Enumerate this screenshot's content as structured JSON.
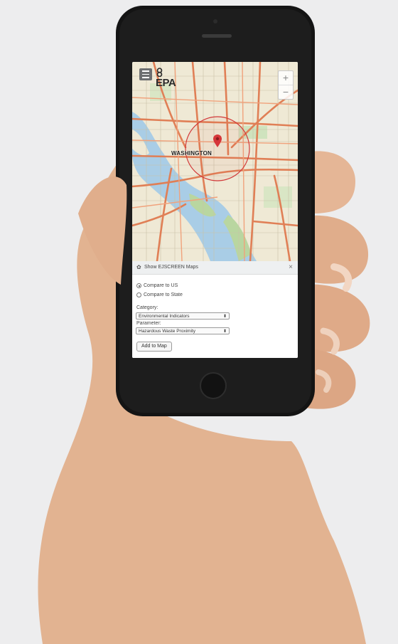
{
  "header": {
    "logo_text": "EPA",
    "menu_icon": "hamburger-icon",
    "zoom_in": "+",
    "zoom_out": "−"
  },
  "map": {
    "city_label": "WASHINGTON",
    "marker_icon": "map-pin-icon"
  },
  "panel": {
    "icon": "gear-icon",
    "title": "Show EJSCREEN Maps",
    "close": "×",
    "compare_options": [
      {
        "label": "Compare to US",
        "selected": true
      },
      {
        "label": "Compare to State",
        "selected": false
      }
    ],
    "category_label": "Category:",
    "category_value": "Environmental Indicators",
    "parameter_label": "Parameter:",
    "parameter_value": "Hazardous Waste Proximity",
    "add_button": "Add to Map"
  },
  "colors": {
    "road_major": "#e07f56",
    "water": "#a7cde6",
    "park": "#b9d6a0",
    "land": "#f0ebd8",
    "radius_ring": "#d23a3a"
  }
}
